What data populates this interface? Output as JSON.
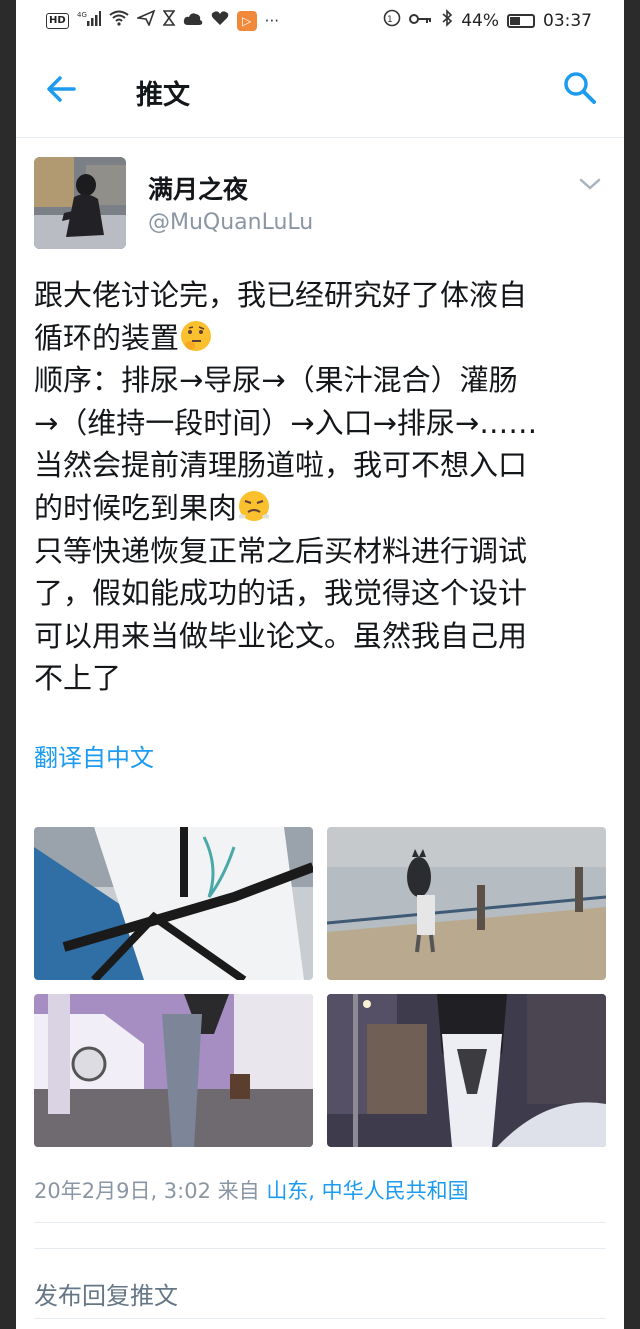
{
  "status_bar": {
    "network_badge": "HD",
    "signal_label": "4G",
    "battery": "44%",
    "battery_level": 0.44,
    "time": "03:37"
  },
  "header": {
    "title": "推文",
    "back_icon": "back-arrow-icon",
    "search_icon": "search-icon"
  },
  "author": {
    "display_name": "满月之夜",
    "handle": "@MuQuanLuLu"
  },
  "tweet": {
    "lines": [
      "跟大佬讨论完，我已经研究好了体液自",
      "循环的装置",
      "顺序：排尿→导尿→（果汁混合）灌肠",
      "→（维持一段时间）→入口→排尿→……",
      "当然会提前清理肠道啦，我可不想入口",
      "的时候吃到果肉",
      "只等快递恢复正常之后买材料进行调试",
      "了，假如能成功的话，我觉得这个设计",
      "可以用来当做毕业论文。虽然我自己用",
      "不上了"
    ],
    "translate_label": "翻译自中文",
    "timestamp": "20年2月9日, 3:02",
    "source_prefix": " 来自 ",
    "location": "山东, 中华人民共和国"
  },
  "reply": {
    "placeholder": "发布回复推文"
  },
  "colors": {
    "accent": "#1d9bf0",
    "text": "#14171a",
    "muted": "#8a96a3"
  }
}
